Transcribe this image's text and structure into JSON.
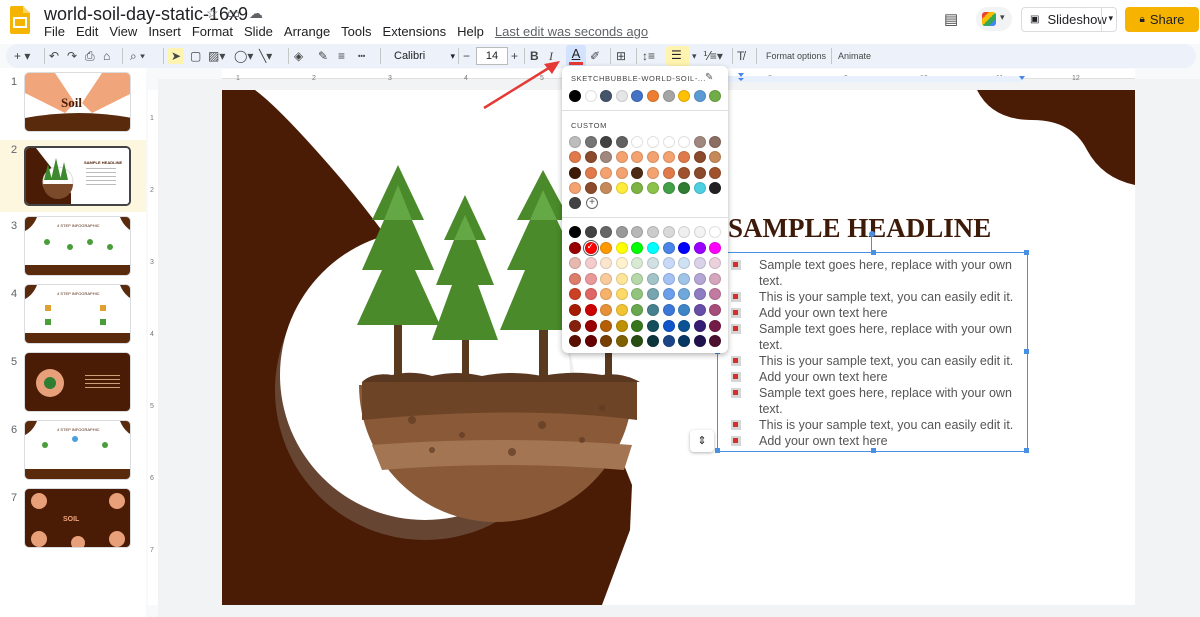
{
  "app": {
    "doc_title": "world-soil-day-static-16x9",
    "menus": [
      "File",
      "Edit",
      "View",
      "Insert",
      "Format",
      "Slide",
      "Arrange",
      "Tools",
      "Extensions",
      "Help"
    ],
    "last_edit": "Last edit was seconds ago",
    "slideshow_label": "Slideshow",
    "share_label": "Share"
  },
  "toolbar": {
    "font": "Calibri",
    "font_size": "14",
    "minus": "−",
    "plus": "+",
    "bold": "B",
    "italic": "I",
    "text_color_glyph": "A",
    "format_options": "Format options",
    "animate": "Animate"
  },
  "filmstrip": {
    "numbers": [
      "1",
      "2",
      "3",
      "4",
      "5",
      "6",
      "7"
    ],
    "active_index": 2
  },
  "slide": {
    "headline": "SAMPLE HEADLINE",
    "bullets": [
      "Sample text goes here, replace with your own",
      "text.",
      "This is your sample text, you can easily edit it.",
      "Add your own text here",
      "Sample text goes here, replace with your own",
      "text.",
      "This is your sample text, you can easily edit it.",
      "Add your own text here",
      "Sample text goes here, replace with your own",
      "text.",
      "This is your sample text, you can easily edit it.",
      "Add your own text here"
    ]
  },
  "color_popup": {
    "theme_name": "SKETCHBUBBLE-WORLD-SOIL-...",
    "custom_label": "CUSTOM",
    "theme_colors": [
      "#000000",
      "#ffffff",
      "#44546a",
      "#e7e6e6",
      "#4472c4",
      "#ed7d31",
      "#a5a5a5",
      "#ffc000",
      "#5b9bd5",
      "#70ad47"
    ],
    "custom_colors": [
      [
        "#bdbdbd",
        "#757575",
        "#424242",
        "#616161",
        "#ffffff",
        "#ffffff",
        "#ffffff",
        "#ffffff",
        "#a1887f",
        "#8d6e63"
      ],
      [
        "#e07a4a",
        "#8b4a2b",
        "#a1887f",
        "#f4a270",
        "#f4a270",
        "#f4a270",
        "#f4a270",
        "#e07a4a",
        "#8b4a2b",
        "#c68a5a"
      ],
      [
        "#3e1a08",
        "#e07a4a",
        "#f4a270",
        "#f4a270",
        "#4e2a14",
        "#f4a270",
        "#e07a4a",
        "#a0522d",
        "#8b4a2b",
        "#a0522d"
      ],
      [
        "#f4a270",
        "#8b4a2b",
        "#c68a5a",
        "#ffeb3b",
        "#7cb342",
        "#8bc34a",
        "#43a047",
        "#2e7d32",
        "#4dd0e1",
        "#212121"
      ],
      [
        "#424242"
      ]
    ],
    "standard_colors": [
      [
        "#000000",
        "#434343",
        "#666666",
        "#999999",
        "#b7b7b7",
        "#cccccc",
        "#d9d9d9",
        "#efefef",
        "#f3f3f3",
        "#ffffff"
      ],
      [
        "#980000",
        "#ff0000",
        "#ff9900",
        "#ffff00",
        "#00ff00",
        "#00ffff",
        "#4a86e8",
        "#0000ff",
        "#9900ff",
        "#ff00ff"
      ],
      [
        "#e6b8af",
        "#f4cccc",
        "#fce5cd",
        "#fff2cc",
        "#d9ead3",
        "#d0e0e3",
        "#c9daf8",
        "#cfe2f3",
        "#d9d2e9",
        "#ead1dc"
      ],
      [
        "#dd7e6b",
        "#ea9999",
        "#f9cb9c",
        "#ffe599",
        "#b6d7a8",
        "#a2c4c9",
        "#a4c2f4",
        "#9fc5e8",
        "#b4a7d6",
        "#d5a6bd"
      ],
      [
        "#cc4125",
        "#e06666",
        "#f6b26b",
        "#ffd966",
        "#93c47d",
        "#76a5af",
        "#6d9eeb",
        "#6fa8dc",
        "#8e7cc3",
        "#c27ba0"
      ],
      [
        "#a61c00",
        "#cc0000",
        "#e69138",
        "#f1c232",
        "#6aa84f",
        "#45818e",
        "#3c78d8",
        "#3d85c6",
        "#674ea7",
        "#a64d79"
      ],
      [
        "#85200c",
        "#990000",
        "#b45f06",
        "#bf9000",
        "#38761d",
        "#134f5c",
        "#1155cc",
        "#0b5394",
        "#351c75",
        "#741b47"
      ],
      [
        "#5b0f00",
        "#660000",
        "#783f04",
        "#7f6000",
        "#274e13",
        "#0c343d",
        "#1c4587",
        "#073763",
        "#20124d",
        "#4c1130"
      ]
    ]
  },
  "colors": {
    "accent_share": "#f6b400",
    "soil_brown": "#4a1c05",
    "selection_blue": "#4a90e2",
    "arrow_red": "#e53935"
  }
}
